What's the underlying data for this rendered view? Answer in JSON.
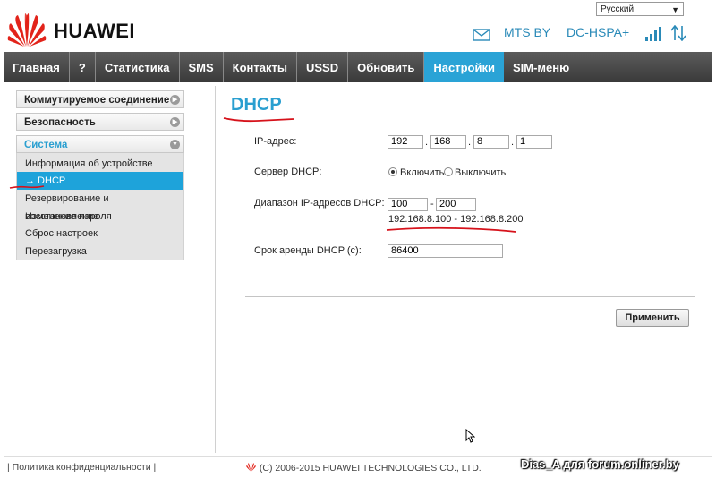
{
  "header": {
    "brand": "HUAWEI",
    "language": "Русский",
    "operator": "MTS BY",
    "network_type": "DC-HSPA+"
  },
  "nav": {
    "items": [
      "Главная",
      "?",
      "Статистика",
      "SMS",
      "Контакты",
      "USSD",
      "Обновить",
      "Настройки",
      "SIM-меню"
    ],
    "active": "Настройки"
  },
  "sidebar": {
    "sections": [
      "Коммутируемое соединение",
      "Безопасность",
      "Система"
    ],
    "system_items": [
      "Информация об устройстве",
      "→ DHCP",
      "Резервирование и восстановление",
      "Изменение пароля",
      "Сброс настроек",
      "Перезагрузка"
    ]
  },
  "main": {
    "title": "DHCP",
    "ip_label": "IP-адрес:",
    "ip": [
      "192",
      "168",
      "8",
      "1"
    ],
    "ip_sep": ".",
    "dhcp_label": "Сервер DHCP:",
    "dhcp_on": "Включить",
    "dhcp_off": "Выключить",
    "range_label": "Диапазон IP-адресов DHCP:",
    "range_start": "100",
    "range_sep": "-",
    "range_end": "200",
    "range_text": "192.168.8.100 - 192.168.8.200",
    "lease_label": "Срок аренды DHCP (с):",
    "lease": "86400",
    "apply": "Применить"
  },
  "footer": {
    "privacy": "Политика конфиденциальности",
    "copyright": "(C) 2006-2015 HUAWEI TECHNOLOGIES CO., LTD.",
    "watermark": "Dias_A для forum.onliner.by"
  },
  "colors": {
    "accent": "#2aa3d6",
    "annotation": "#d6121b",
    "brand": "#e2231a"
  }
}
